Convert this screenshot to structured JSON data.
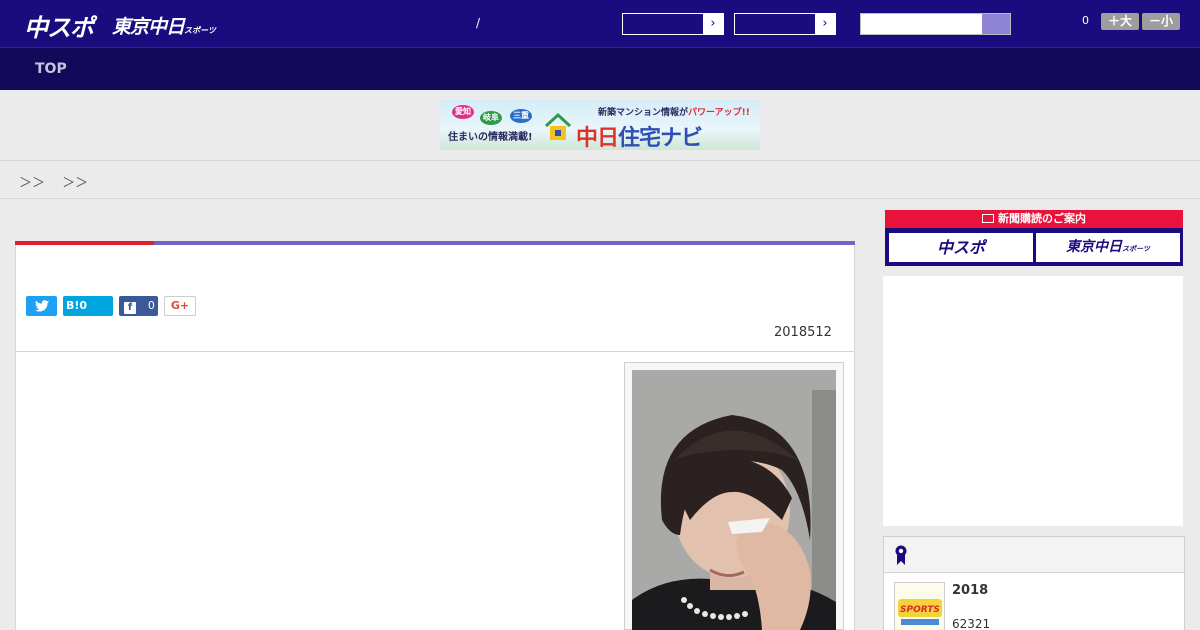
{
  "header": {
    "logo_chuspo": "中スポ",
    "logo_tokyo": "東京中日",
    "logo_tokyo_small": "スポーツ",
    "separator": "/",
    "font_count": "0",
    "font_larger": "＋大",
    "font_smaller": "－小"
  },
  "nav": {
    "top_label": "TOP"
  },
  "banner": {
    "bubbles": [
      "愛知",
      "岐阜",
      "三重"
    ],
    "subtitle": "住まいの情報満載!",
    "headline_prefix": "新築マンション情報が",
    "headline_emph": "パワーアップ!!",
    "brand_a": "中日",
    "brand_b": "住宅ナビ"
  },
  "breadcrumb": "＞＞　 ＞＞",
  "article": {
    "hatena_label": "B!0",
    "facebook_count": "0",
    "googleplus_label": "G+",
    "date": "2018512"
  },
  "sidebar": {
    "subscribe_header": "新聞購読のご案内",
    "subscribe_chuspo": "中スポ",
    "subscribe_tokyo": "東京中日",
    "subscribe_tokyo_small": "スポーツ",
    "ranking_item_title": "2018",
    "ranking_item_number": "62321"
  },
  "colors": {
    "header_bg": "#1a0c7e",
    "nav_bg": "#12095a",
    "accent_red": "#e0212d",
    "accent_purple": "#7562c4"
  }
}
